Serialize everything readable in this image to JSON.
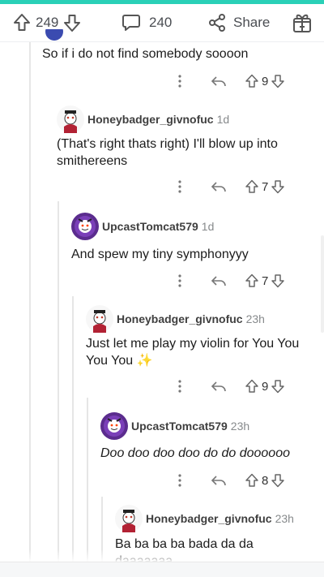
{
  "action_bar": {
    "upvotes": "249",
    "comments": "240",
    "share_label": "Share"
  },
  "comments": [
    {
      "username": "",
      "time": "",
      "body": "So if i do not find somebody soooon",
      "votes": "9"
    },
    {
      "username": "Honeybadger_givnofuc",
      "time": "1d",
      "body": "(That's right thats right) I'll blow up into smithereens",
      "votes": "7"
    },
    {
      "username": "UpcastTomcat579",
      "time": "1d",
      "body": "And spew my tiny symphonyyy",
      "votes": "7"
    },
    {
      "username": "Honeybadger_givnofuc",
      "time": "23h",
      "body": "Just let me play my violin for You You You You ✨",
      "votes": "9"
    },
    {
      "username": "UpcastTomcat579",
      "time": "23h",
      "body": "Doo doo doo doo do do doooooo",
      "votes": "8"
    },
    {
      "username": "Honeybadger_givnofuc",
      "time": "23h",
      "body": "Ba ba ba ba bada da da daaaaaaa",
      "votes": ""
    }
  ],
  "colors": {
    "accent_strip": "#2ad0b7",
    "thread_line": "#e6e6e6",
    "meta_gray": "#878a8c"
  },
  "icons": [
    "upvote-icon",
    "downvote-icon",
    "comment-icon",
    "share-icon",
    "award-icon",
    "more-icon",
    "reply-icon"
  ]
}
